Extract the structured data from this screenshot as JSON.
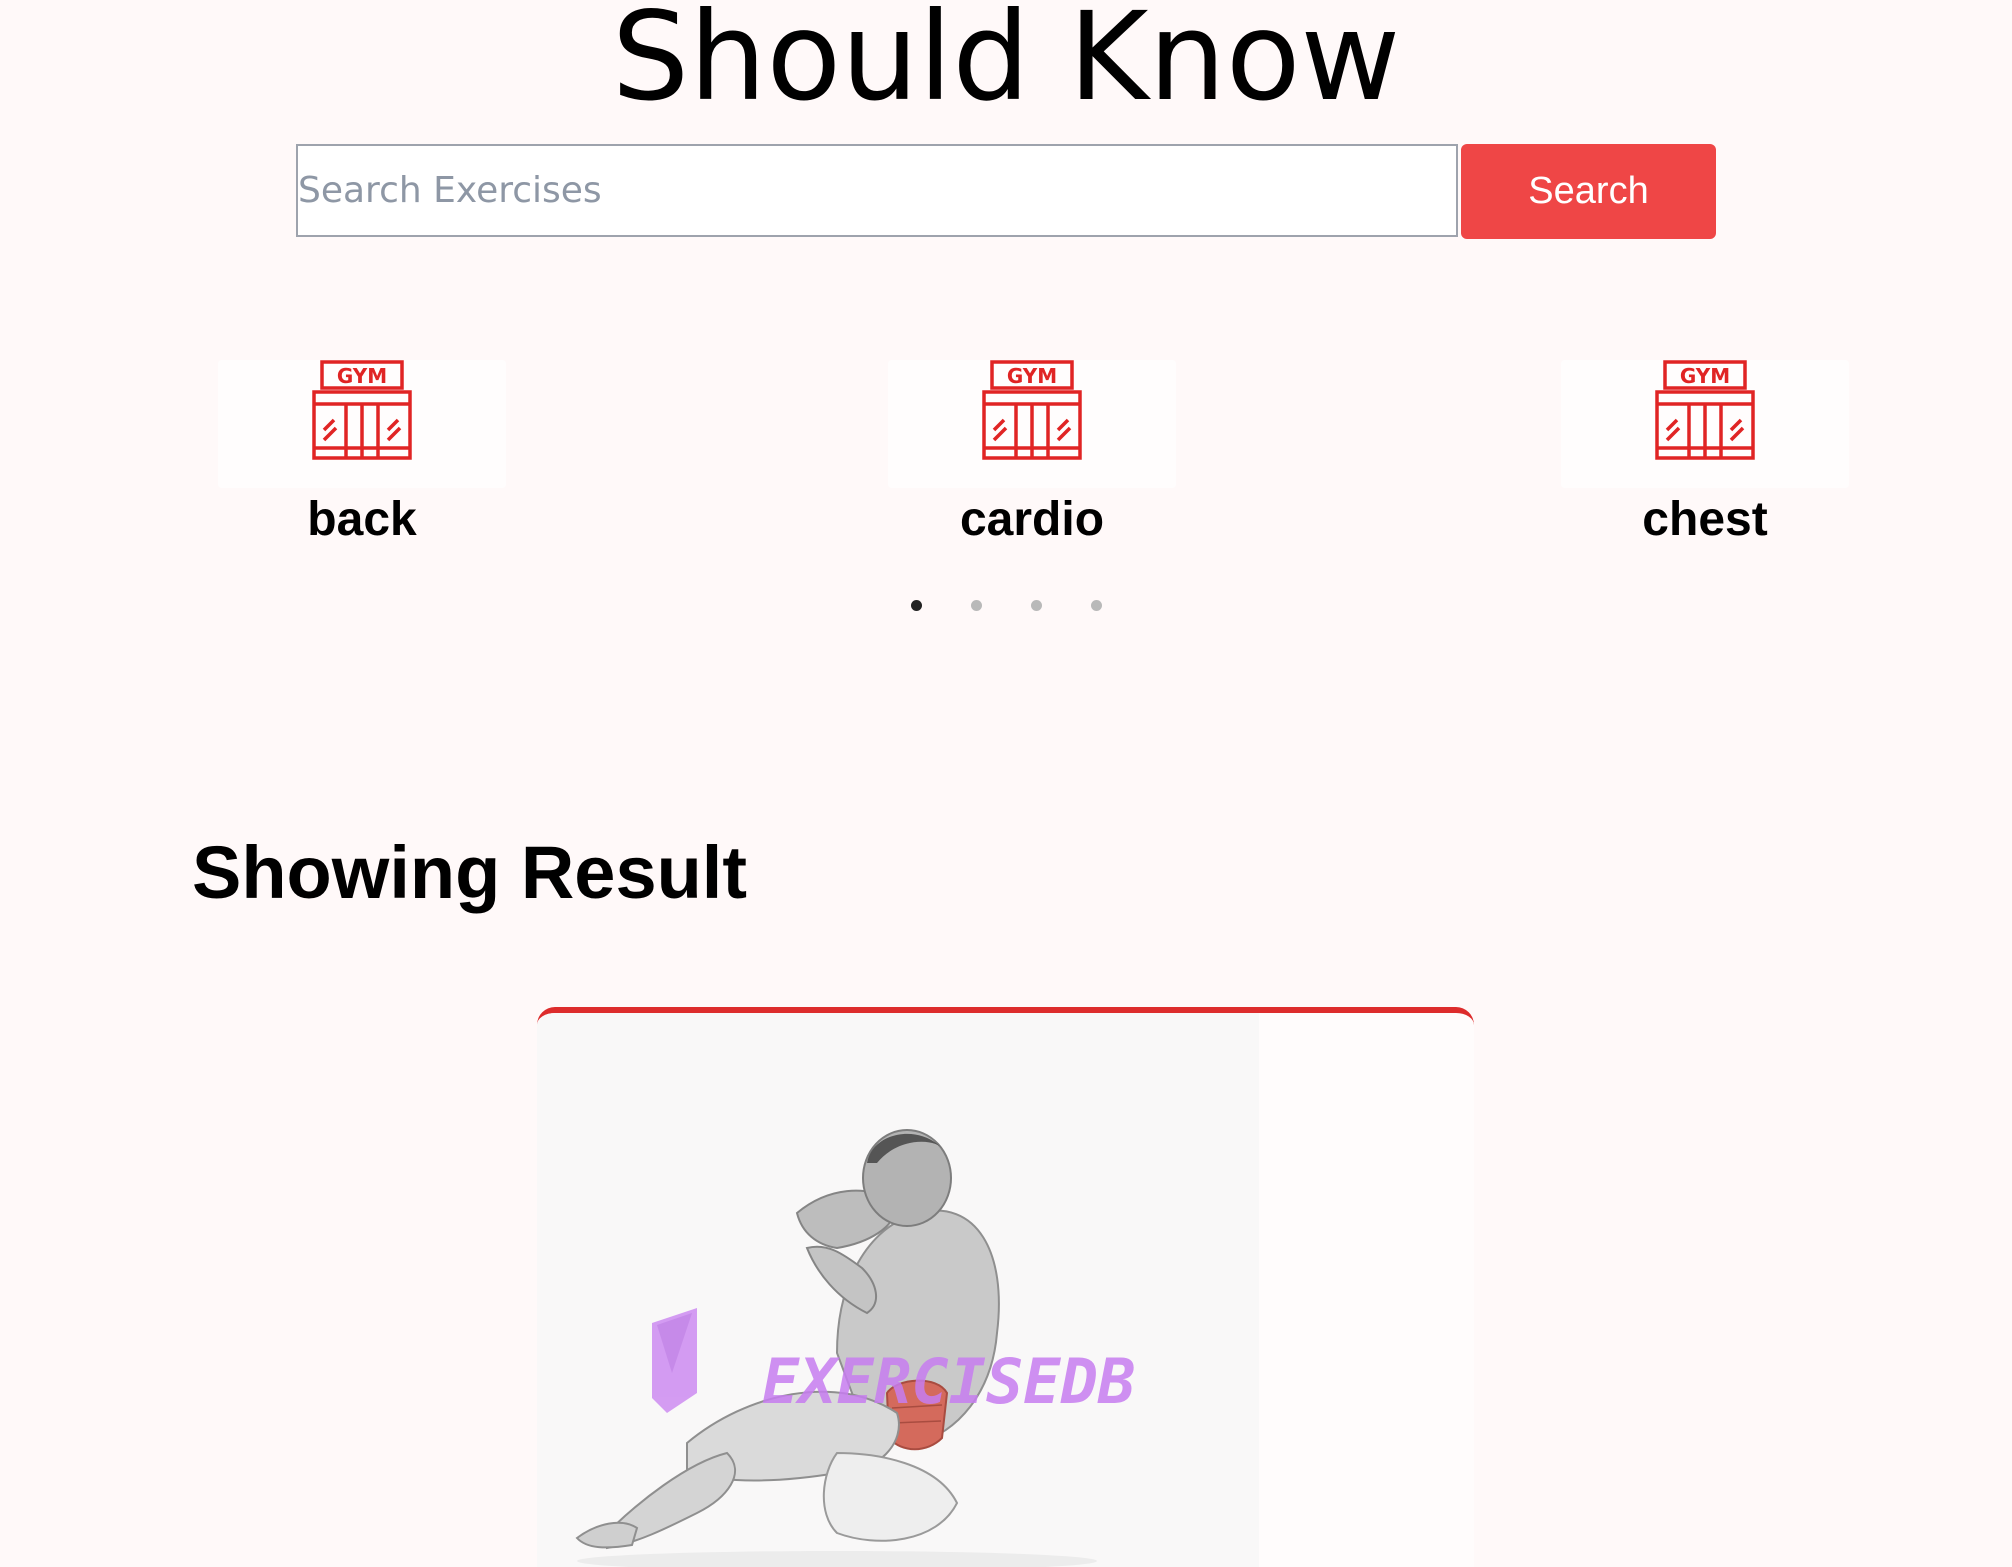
{
  "hero": {
    "title": "Should Know"
  },
  "search": {
    "placeholder": "Search Exercises",
    "value": "",
    "button_label": "Search"
  },
  "categories": [
    {
      "label": "back",
      "icon": "gym-building-icon"
    },
    {
      "label": "cardio",
      "icon": "gym-building-icon"
    },
    {
      "label": "chest",
      "icon": "gym-building-icon"
    }
  ],
  "icon_sign_text": "GYM",
  "pagination": {
    "total": 4,
    "active": 1
  },
  "results": {
    "heading": "Showing Result"
  },
  "result_card": {
    "image": "exercise-illustration",
    "watermark": "EXERCISEDB"
  },
  "colors": {
    "accent": "#ef4646",
    "card_border": "#dd2c2c",
    "icon": "#e02424",
    "background": "#fff9f9",
    "watermark": "#c77df0"
  }
}
